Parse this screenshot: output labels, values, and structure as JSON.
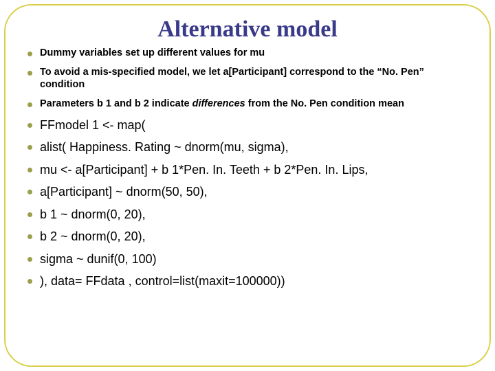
{
  "title": "Alternative model",
  "bullets": {
    "b0": "Dummy variables set up different values for mu",
    "b1": "To avoid a mis-specified model, we let a[Participant] correspond to the “No. Pen” condition",
    "b2_pre": "Parameters b 1 and b 2 indicate ",
    "b2_ital": "differences",
    "b2_post": " from the No. Pen condition mean",
    "b3": "FFmodel 1 <- map(",
    "b4": "alist( Happiness. Rating ~ dnorm(mu, sigma),",
    "b5": "mu <- a[Participant] + b 1*Pen. In. Teeth + b 2*Pen. In. Lips,",
    "b6": "a[Participant] ~ dnorm(50, 50),",
    "b7": "b 1 ~ dnorm(0, 20),",
    "b8": "b 2 ~ dnorm(0, 20),",
    "b9": "sigma ~ dunif(0, 100)",
    "b10": "), data= FFdata ,  control=list(maxit=100000))"
  }
}
